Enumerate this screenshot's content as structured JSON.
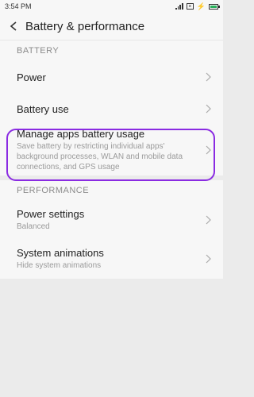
{
  "status": {
    "time": "3:54 PM"
  },
  "header": {
    "title": "Battery & performance"
  },
  "sections": {
    "battery": {
      "label": "BATTERY",
      "items": [
        {
          "title": "Power",
          "subtitle": ""
        },
        {
          "title": "Battery use",
          "subtitle": ""
        },
        {
          "title": "Manage apps battery usage",
          "subtitle": "Save battery by restricting individual apps' background processes, WLAN and mobile data connections, and GPS usage"
        }
      ]
    },
    "performance": {
      "label": "PERFORMANCE",
      "items": [
        {
          "title": "Power settings",
          "subtitle": "Balanced"
        },
        {
          "title": "System animations",
          "subtitle": "Hide system animations"
        }
      ]
    }
  },
  "colors": {
    "highlight": "#8a2be2",
    "battery_fill": "#2ab05c"
  },
  "icons": [
    "back-arrow-icon",
    "chevron-right-icon",
    "signal-icon",
    "close-box-icon",
    "charging-bolt-icon",
    "battery-icon"
  ]
}
